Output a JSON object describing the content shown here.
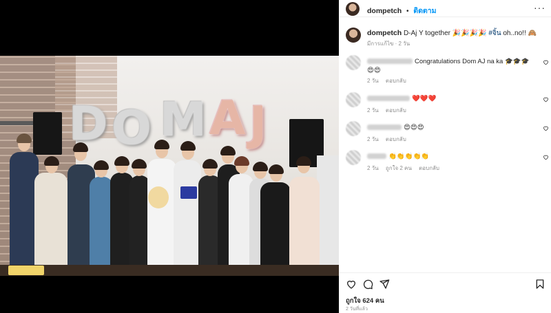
{
  "post": {
    "username": "dompetch",
    "follow_label": "ติดตาม",
    "separator": "•",
    "more_label": "···"
  },
  "caption": {
    "username": "dompetch",
    "text": "D-Aj Y together 🎉🎉🎉🎉",
    "hashtag": "#จิ้น",
    "text_after": "oh..no!! 🙈",
    "meta": "มีการแก้ไข · 2 วัน"
  },
  "photo": {
    "balloon_text": [
      "D",
      "O",
      "M",
      "A",
      "J"
    ]
  },
  "comments": [
    {
      "text": "Congratulations Dom AJ na ka 🎓🎓🎓😍😍",
      "age": "2 วัน",
      "likes": "",
      "reply": "ตอบกลับ"
    },
    {
      "text": "❤️❤️❤️",
      "age": "2 วัน",
      "likes": "",
      "reply": "ตอบกลับ"
    },
    {
      "text": "😍😍😍",
      "age": "2 วัน",
      "likes": "",
      "reply": "ตอบกลับ"
    },
    {
      "text": "👏👏👏👏👏",
      "age": "2 วัน",
      "likes": "ถูกใจ 2 คน",
      "reply": "ตอบกลับ"
    }
  ],
  "footer": {
    "likes": "ถูกใจ 624 คน",
    "date": "2 วันที่แล้ว"
  },
  "icons": {
    "like": "heart-icon",
    "comment": "comment-icon",
    "share": "send-icon",
    "save": "bookmark-icon",
    "comment_like": "small-heart-icon"
  },
  "colors": {
    "follow": "#0095f6",
    "hashtag": "#00376b",
    "muted": "#8e8e8e"
  }
}
